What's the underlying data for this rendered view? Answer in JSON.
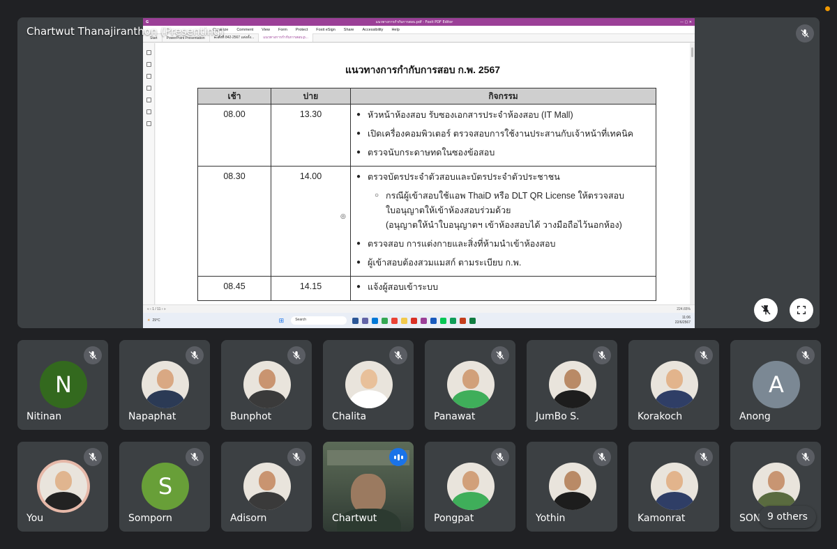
{
  "presenter": {
    "label": "Chartwut Thanajiranthon (Presenting)"
  },
  "screen": {
    "window_title": "แนวทางการกำกับการสอบ.pdf - Foxit PDF Editor",
    "menu": [
      "Organize",
      "Comment",
      "View",
      "Form",
      "Protect",
      "Foxit eSign",
      "Share",
      "Accessibility",
      "Help"
    ],
    "tabs": [
      "Start",
      "PowerPoint Presentation",
      "คำสั่งที่ 842-2567 แต่งตั้ง...",
      "แนวทางการกำกับการสอบ.p..."
    ],
    "page_indicator": "1 / 11",
    "zoom": "224.65%",
    "search_placeholder": "Search",
    "weather": "29°C",
    "clock_time": "11:06",
    "clock_date": "22/6/2567"
  },
  "document": {
    "title": "แนวทางการกำกับการสอบ ก.พ. 2567",
    "columns": [
      "เช้า",
      "บ่าย",
      "กิจกรรม"
    ],
    "rows": [
      {
        "morning": "08.00",
        "afternoon": "13.30",
        "items": [
          "หัวหน้าห้องสอบ รับซองเอกสารประจำห้องสอบ (IT Mall)",
          "เปิดเครื่องคอมพิวเตอร์ ตรวจสอบการใช้งานประสานกับเจ้าหน้าที่เทคนิค",
          "ตรวจนับกระดาษทดในซองข้อสอบ"
        ]
      },
      {
        "morning": "08.30",
        "afternoon": "14.00",
        "items": [
          "ตรวจบัตรประจำตัวสอบและบัตรประจำตัวประชาชน",
          "กรณีผู้เข้าสอบใช้แอพ ThaiD หรือ DLT QR License ให้ตรวจสอบ",
          "ใบอนุญาตให้เข้าห้องสอบร่วมด้วย",
          "(อนุญาตให้นำใบอนุญาตฯ เข้าห้องสอบได้ วางมือถือไว้นอกห้อง)",
          "ตรวจสอบ การแต่งกายและสิ่งที่ห้ามนำเข้าห้องสอบ",
          "ผู้เข้าสอบต้องสวมแมสก์ ตามระเบียบ ก.พ."
        ]
      },
      {
        "morning": "08.45",
        "afternoon": "14.15",
        "items": [
          "แจ้งผู้สอบเข้าระบบ"
        ]
      }
    ]
  },
  "participants": [
    {
      "name": "Nitinan",
      "initial": "N",
      "color": "#33691e"
    },
    {
      "name": "Napaphat"
    },
    {
      "name": "Bunphot"
    },
    {
      "name": "Chalita"
    },
    {
      "name": "Panawat"
    },
    {
      "name": "JumBo S."
    },
    {
      "name": "Korakoch"
    },
    {
      "name": "Anong",
      "initial": "A",
      "color": "#7b8894"
    },
    {
      "name": "You"
    },
    {
      "name": "Somporn",
      "initial": "S",
      "color": "#689f38"
    },
    {
      "name": "Adisorn"
    },
    {
      "name": "Chartwut"
    },
    {
      "name": "Pongpat"
    },
    {
      "name": "Yothin"
    },
    {
      "name": "Kamonrat"
    },
    {
      "name": "SON"
    }
  ],
  "others_label": "9 others",
  "accent_colors": {
    "speaking": "#1a73e8",
    "recording": "#f29900",
    "foxit": "#9b3f97"
  }
}
